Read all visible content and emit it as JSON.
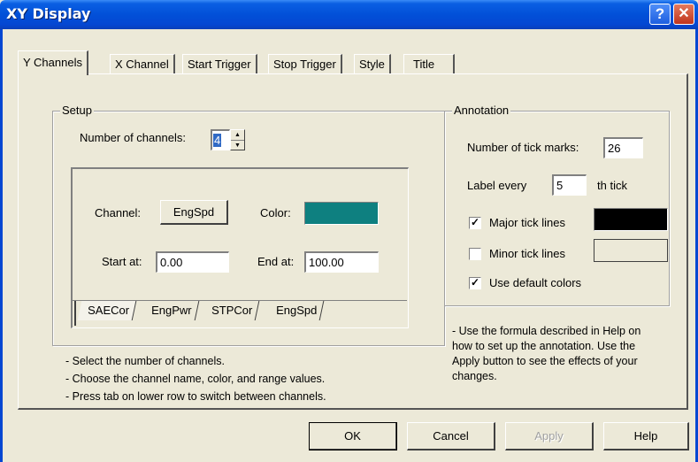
{
  "window": {
    "title": "XY Display",
    "help_glyph": "?",
    "close_glyph": "✕"
  },
  "tabs": [
    "Y Channels",
    "X Channel",
    "Start Trigger",
    "Stop Trigger",
    "Style",
    "Title"
  ],
  "setup": {
    "legend": "Setup",
    "num_channels_label": "Number of channels:",
    "num_channels_value": "4",
    "channel_label": "Channel:",
    "channel_button": "EngSpd",
    "color_label": "Color:",
    "color_value": "#0e8080",
    "start_label": "Start at:",
    "start_value": "0.00",
    "end_label": "End at:",
    "end_value": "100.00",
    "channel_tabs": [
      "SAECor",
      "EngPwr",
      "STPCor",
      "EngSpd"
    ]
  },
  "setup_notes": [
    "- Select the number of channels.",
    "- Choose the channel name, color, and range values.",
    "- Press tab on lower row to switch between channels."
  ],
  "annotation": {
    "legend": "Annotation",
    "tick_marks_label": "Number of tick marks:",
    "tick_marks_value": "26",
    "label_every_label": "Label every",
    "label_every_value": "5",
    "label_every_suffix": "th tick",
    "major_label": "Major tick lines",
    "major_checked": true,
    "major_color": "#000000",
    "minor_label": "Minor tick lines",
    "minor_checked": false,
    "minor_color": "#ece9d8",
    "default_colors_label": "Use default colors",
    "default_colors_checked": true
  },
  "annotation_notes": [
    "- Use the formula described in Help on",
    "how to set up the annotation.  Use the",
    "Apply button to see the effects of your",
    "changes."
  ],
  "buttons": {
    "ok": "OK",
    "cancel": "Cancel",
    "apply": "Apply",
    "help": "Help"
  }
}
